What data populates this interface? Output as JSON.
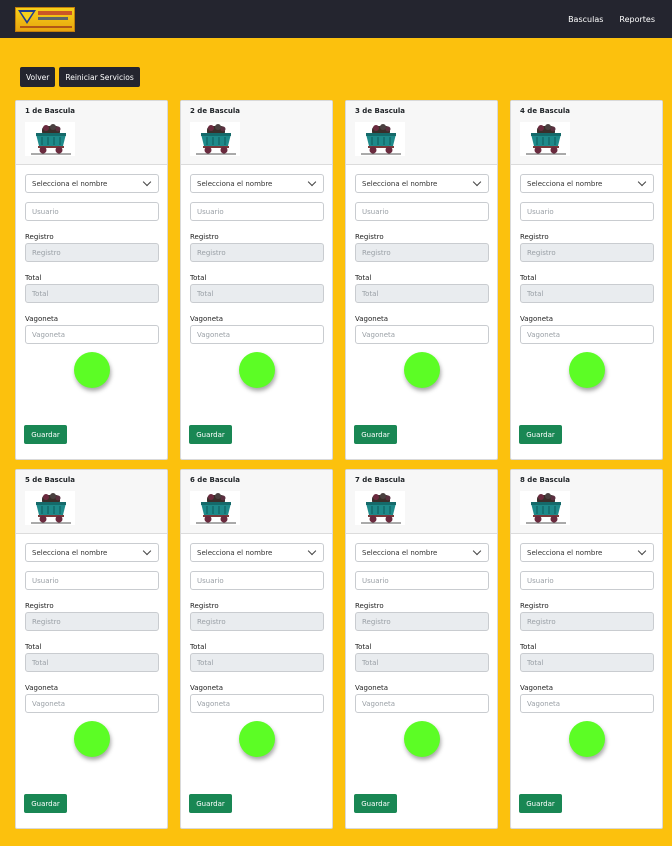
{
  "nav": {
    "links": [
      "Basculas",
      "Reportes"
    ]
  },
  "actions": {
    "back": "Volver",
    "restart": "Reiniciar Servicios"
  },
  "cards": [
    {
      "title": "1 de Bascula",
      "select": "Selecciona el nombre",
      "user_ph": "Usuario",
      "registro_label": "Registro",
      "registro_ph": "Registro",
      "total_label": "Total",
      "total_ph": "Total",
      "vagoneta_label": "Vagoneta",
      "vagoneta_ph": "Vagoneta",
      "save": "Guardar",
      "status_color": "#5cfd25"
    },
    {
      "title": "2 de Bascula",
      "select": "Selecciona el nombre",
      "user_ph": "Usuario",
      "registro_label": "Registro",
      "registro_ph": "Registro",
      "total_label": "Total",
      "total_ph": "Total",
      "vagoneta_label": "Vagoneta",
      "vagoneta_ph": "Vagoneta",
      "save": "Guardar",
      "status_color": "#5cfd25"
    },
    {
      "title": "3 de Bascula",
      "select": "Selecciona el nombre",
      "user_ph": "Usuario",
      "registro_label": "Registro",
      "registro_ph": "Registro",
      "total_label": "Total",
      "total_ph": "Total",
      "vagoneta_label": "Vagoneta",
      "vagoneta_ph": "Vagoneta",
      "save": "Guardar",
      "status_color": "#5cfd25"
    },
    {
      "title": "4 de Bascula",
      "select": "Selecciona el nombre",
      "user_ph": "Usuario",
      "registro_label": "Registro",
      "registro_ph": "Registro",
      "total_label": "Total",
      "total_ph": "Total",
      "vagoneta_label": "Vagoneta",
      "vagoneta_ph": "Vagoneta",
      "save": "Guardar",
      "status_color": "#5cfd25"
    },
    {
      "title": "5 de Bascula",
      "select": "Selecciona el nombre",
      "user_ph": "Usuario",
      "registro_label": "Registro",
      "registro_ph": "Registro",
      "total_label": "Total",
      "total_ph": "Total",
      "vagoneta_label": "Vagoneta",
      "vagoneta_ph": "Vagoneta",
      "save": "Guardar",
      "status_color": "#5cfd25"
    },
    {
      "title": "6 de Bascula",
      "select": "Selecciona el nombre",
      "user_ph": "Usuario",
      "registro_label": "Registro",
      "registro_ph": "Registro",
      "total_label": "Total",
      "total_ph": "Total",
      "vagoneta_label": "Vagoneta",
      "vagoneta_ph": "Vagoneta",
      "save": "Guardar",
      "status_color": "#5cfd25"
    },
    {
      "title": "7 de Bascula",
      "select": "Selecciona el nombre",
      "user_ph": "Usuario",
      "registro_label": "Registro",
      "registro_ph": "Registro",
      "total_label": "Total",
      "total_ph": "Total",
      "vagoneta_label": "Vagoneta",
      "vagoneta_ph": "Vagoneta",
      "save": "Guardar",
      "status_color": "#5cfd25"
    },
    {
      "title": "8 de Bascula",
      "select": "Selecciona el nombre",
      "user_ph": "Usuario",
      "registro_label": "Registro",
      "registro_ph": "Registro",
      "total_label": "Total",
      "total_ph": "Total",
      "vagoneta_label": "Vagoneta",
      "vagoneta_ph": "Vagoneta",
      "save": "Guardar",
      "status_color": "#5cfd25"
    }
  ],
  "colors": {
    "page_bg": "#fcc10d",
    "navbar": "#24252f",
    "save_button": "#198754",
    "status_ok": "#5cfd25"
  },
  "icons": {
    "brand": "company-logo",
    "cart": "mine-cart-icon",
    "select": "chevron-down-icon"
  }
}
